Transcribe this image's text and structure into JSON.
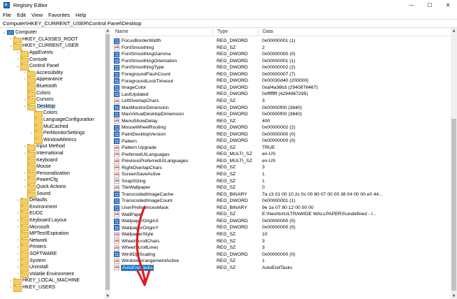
{
  "window": {
    "title": "Registry Editor",
    "minimize_glyph": "—",
    "maximize_glyph": "☐",
    "close_glyph": "✕"
  },
  "menu": [
    "File",
    "Edit",
    "View",
    "Favorites",
    "Help"
  ],
  "address": "Computer\\HKEY_CURRENT_USER\\Control Panel\\Desktop",
  "tree": [
    {
      "label": "Computer",
      "level": 0,
      "expanded": true,
      "icon": "computer-icon"
    },
    {
      "label": "HKEY_CLASSES_ROOT",
      "level": 1,
      "expanded": false
    },
    {
      "label": "HKEY_CURRENT_USER",
      "level": 1,
      "expanded": true
    },
    {
      "label": "AppEvents",
      "level": 2,
      "expanded": false
    },
    {
      "label": "Console",
      "level": 2,
      "expanded": false
    },
    {
      "label": "Control Panel",
      "level": 2,
      "expanded": true
    },
    {
      "label": "Accessibility",
      "level": 3,
      "expanded": false
    },
    {
      "label": "Appearance",
      "level": 3,
      "expanded": false
    },
    {
      "label": "Bluetooth",
      "level": 3,
      "expanded": null
    },
    {
      "label": "Colors",
      "level": 3,
      "expanded": null
    },
    {
      "label": "Cursors",
      "level": 3,
      "expanded": false
    },
    {
      "label": "Desktop",
      "level": 3,
      "expanded": true,
      "selected": true
    },
    {
      "label": "Colors",
      "level": 4,
      "expanded": null
    },
    {
      "label": "LanguageConfiguration",
      "level": 4,
      "expanded": null
    },
    {
      "label": "MuiCached",
      "level": 4,
      "expanded": null
    },
    {
      "label": "PerMonitorSettings",
      "level": 4,
      "expanded": false
    },
    {
      "label": "WindowMetrics",
      "level": 4,
      "expanded": null
    },
    {
      "label": "Input Method",
      "level": 3,
      "expanded": false
    },
    {
      "label": "International",
      "level": 3,
      "expanded": false
    },
    {
      "label": "Keyboard",
      "level": 3,
      "expanded": null
    },
    {
      "label": "Mouse",
      "level": 3,
      "expanded": null
    },
    {
      "label": "Personalization",
      "level": 3,
      "expanded": false
    },
    {
      "label": "PowerCfg",
      "level": 3,
      "expanded": false
    },
    {
      "label": "Quick Actions",
      "level": 3,
      "expanded": false
    },
    {
      "label": "Sound",
      "level": 3,
      "expanded": null
    },
    {
      "label": "Defaults",
      "level": 2,
      "expanded": false
    },
    {
      "label": "Environment",
      "level": 2,
      "expanded": null
    },
    {
      "label": "EUDC",
      "level": 2,
      "expanded": false
    },
    {
      "label": "Keyboard Layout",
      "level": 2,
      "expanded": false
    },
    {
      "label": "Microsoft",
      "level": 2,
      "expanded": false
    },
    {
      "label": "MPTest!Expiration",
      "level": 2,
      "expanded": null
    },
    {
      "label": "Network",
      "level": 2,
      "expanded": false
    },
    {
      "label": "Printers",
      "level": 2,
      "expanded": false
    },
    {
      "label": "SOFTWARE",
      "level": 2,
      "expanded": false
    },
    {
      "label": "System",
      "level": 2,
      "expanded": false
    },
    {
      "label": "Uninstall",
      "level": 2,
      "expanded": false
    },
    {
      "label": "Volatile Environment",
      "level": 2,
      "expanded": false
    },
    {
      "label": "HKEY_LOCAL_MACHINE",
      "level": 1,
      "expanded": false
    },
    {
      "label": "HKEY_USERS",
      "level": 1,
      "expanded": false
    }
  ],
  "columns": {
    "name": "Name",
    "type": "Type",
    "data": "Data"
  },
  "values": [
    {
      "name": "FocusBorderWidth",
      "type": "REG_DWORD",
      "data": "0x00000001 (1)"
    },
    {
      "name": "FontSmoothing",
      "type": "REG_SZ",
      "data": "2"
    },
    {
      "name": "FontSmoothingGamma",
      "type": "REG_DWORD",
      "data": "0x00000000 (0)"
    },
    {
      "name": "FontSmoothingOrientation",
      "type": "REG_DWORD",
      "data": "0x00000001 (1)"
    },
    {
      "name": "FontSmoothingType",
      "type": "REG_DWORD",
      "data": "0x00000002 (2)"
    },
    {
      "name": "ForegroundFlashCount",
      "type": "REG_DWORD",
      "data": "0x00000007 (7)"
    },
    {
      "name": "ForegroundLockTimeout",
      "type": "REG_DWORD",
      "data": "0x00030d40 (200000)"
    },
    {
      "name": "ImageColor",
      "type": "REG_DWORD",
      "data": "0xaf4a36b3 (2940876467)"
    },
    {
      "name": "LastUpdated",
      "type": "REG_DWORD",
      "data": "0xffffffff (4294967295)"
    },
    {
      "name": "LeftOverlapChars",
      "type": "REG_SZ",
      "data": "3"
    },
    {
      "name": "MaxMonitorDimension",
      "type": "REG_DWORD",
      "data": "0x00000f00 (3840)"
    },
    {
      "name": "MaxVirtualDesktopDimension",
      "type": "REG_DWORD",
      "data": "0x00000f00 (3840)"
    },
    {
      "name": "MenuShowDelay",
      "type": "REG_SZ",
      "data": "400"
    },
    {
      "name": "MouseWheelRouting",
      "type": "REG_DWORD",
      "data": "0x00000002 (2)"
    },
    {
      "name": "PaintDesktopVersion",
      "type": "REG_DWORD",
      "data": "0x00000000 (0)"
    },
    {
      "name": "Pattern",
      "type": "REG_DWORD",
      "data": "0x00000000 (0)"
    },
    {
      "name": "Pattern Upgrade",
      "type": "REG_SZ",
      "data": "TRUE"
    },
    {
      "name": "PreferredUILanguages",
      "type": "REG_MULTI_SZ",
      "data": "en-US"
    },
    {
      "name": "PreviousPreferredUILanguages",
      "type": "REG_MULTI_SZ",
      "data": "en-US"
    },
    {
      "name": "RightOverlapChars",
      "type": "REG_SZ",
      "data": "3"
    },
    {
      "name": "ScreenSaveActive",
      "type": "REG_SZ",
      "data": "1"
    },
    {
      "name": "SnapSizing",
      "type": "REG_SZ",
      "data": "1"
    },
    {
      "name": "TileWallpaper",
      "type": "REG_SZ",
      "data": "0"
    },
    {
      "name": "TranscodedImageCache",
      "type": "REG_BINARY",
      "data": "7a c3 01 00 10 2c 0c 00 80 07 00 00 38 04 00 00 e0 44..."
    },
    {
      "name": "TranscodedImageCount",
      "type": "REG_DWORD",
      "data": "0x00000001 (1)"
    },
    {
      "name": "UserPreferencesMask",
      "type": "REG_BINARY",
      "data": "9e 1e 07 80 12 00 00 00"
    },
    {
      "name": "WallPaper",
      "type": "REG_SZ",
      "data": "E:\\Neshto\\ULTRAWIDE WALLPAPERS\\undefined - I..."
    },
    {
      "name": "WallpaperOriginX",
      "type": "REG_DWORD",
      "data": "0x00000000 (0)"
    },
    {
      "name": "WallpaperOriginY",
      "type": "REG_DWORD",
      "data": "0x00000000 (0)"
    },
    {
      "name": "WallpaperStyle",
      "type": "REG_SZ",
      "data": "10"
    },
    {
      "name": "WheelScrollChars",
      "type": "REG_SZ",
      "data": "3"
    },
    {
      "name": "WheelScrollLines",
      "type": "REG_SZ",
      "data": "3"
    },
    {
      "name": "Win8DpiScaling",
      "type": "REG_DWORD",
      "data": "0x00000000 (0)"
    },
    {
      "name": "WindowArrangementActive",
      "type": "REG_SZ",
      "data": "1"
    },
    {
      "name": "AutoEndTasks",
      "type": "REG_SZ",
      "data": "AutoEndTasks",
      "selected": true
    }
  ],
  "colors": {
    "selection": "#0078d7",
    "tree_selection": "#cce8ff",
    "annotation": "#e0191f",
    "folder": "#f6cf5a"
  }
}
